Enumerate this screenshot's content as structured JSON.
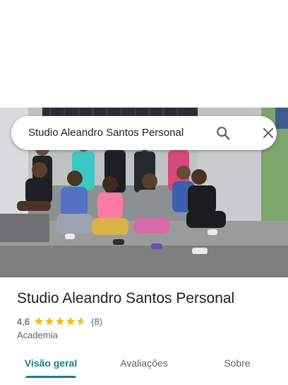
{
  "search": {
    "query": "Studio Aleandro Santos Personal",
    "icon_search": "search-icon",
    "icon_close": "close-icon"
  },
  "place": {
    "name": "Studio Aleandro Santos Personal",
    "rating": "4,6",
    "rating_stars": 4.6,
    "reviews_count": "(8)",
    "category": "Academia"
  },
  "tabs": [
    {
      "label": "Visão geral",
      "active": true
    },
    {
      "label": "Avaliações",
      "active": false
    },
    {
      "label": "Sobre",
      "active": false
    }
  ],
  "colors": {
    "accent": "#1a7f86",
    "star": "#fbbc04",
    "text_primary": "#202124",
    "text_secondary": "#5f6368"
  }
}
